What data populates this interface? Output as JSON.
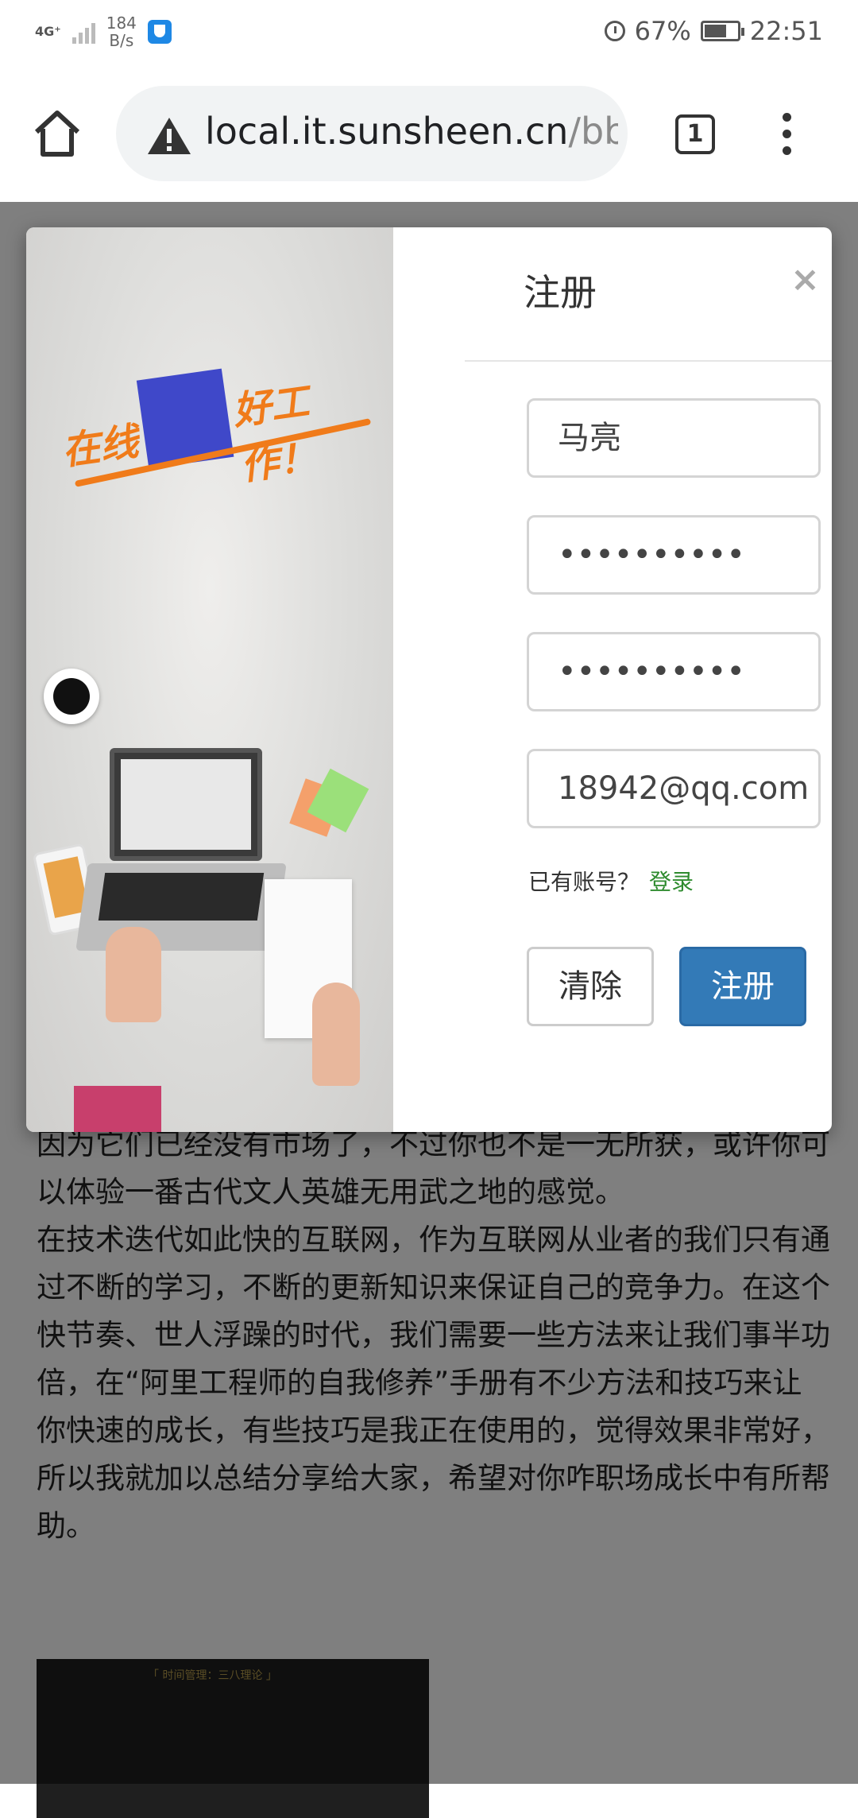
{
  "status_bar": {
    "network": "4G⁺",
    "speed_value": "184",
    "speed_unit": "B/s",
    "battery_percent": "67%",
    "battery_level": 0.67,
    "time": "22:51"
  },
  "browser": {
    "url_host": "local.it.sunsheen.cn",
    "url_path_fragment": "/bb",
    "tab_count": "1"
  },
  "modal": {
    "title": "注册",
    "close_glyph": "×",
    "illustration_text_left": "在线",
    "illustration_text_right": "好工作！",
    "fields": {
      "username_value": "马亮",
      "password_value": "••••••••••",
      "confirm_password_value": "••••••••••",
      "email_value": "18942@qq.com"
    },
    "login_hint": "已有账号？",
    "login_link": "登录",
    "clear_button": "清除",
    "submit_button": "注册"
  },
  "article": {
    "paragraphs": [
      "因为它们已经没有市场了，不过你也不是一无所获，或许你可以体验一番古代文人英雄无用武之地的感觉。",
      "在技术迭代如此快的互联网，作为互联网从业者的我们只有通过不断的学习，不断的更新知识来保证自己的竞争力。在这个快节奏、世人浮躁的时代，我们需要一些方法来让我们事半功倍，在“阿里工程师的自我修养”手册有不少方法和技巧来让你快速的成长，有些技巧是我正在使用的，觉得效果非常好，所以我就加以总结分享给大家，希望对你咋职场成长中有所帮助。"
    ],
    "image_caption": "「 时间管理：三八理论 」"
  },
  "colors": {
    "submit_button": "#337ab7",
    "login_link": "#2e8b2e",
    "overlay": "rgba(0,0,0,0.5)",
    "slogan": "#f07b1a",
    "redaction_block": "#3f48c9"
  }
}
